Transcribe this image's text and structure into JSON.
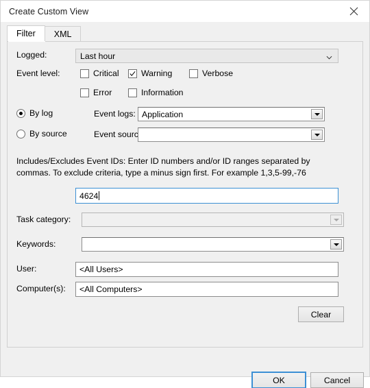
{
  "window": {
    "title": "Create Custom View",
    "close_icon": "close-icon"
  },
  "tabs": [
    {
      "label": "Filter",
      "active": true
    },
    {
      "label": "XML",
      "active": false
    }
  ],
  "filter": {
    "logged": {
      "label": "Logged:",
      "value": "Last hour",
      "chevron_icon": "chevron-down-icon"
    },
    "event_level": {
      "label": "Event level:",
      "options": [
        {
          "label": "Critical",
          "checked": false
        },
        {
          "label": "Warning",
          "checked": true
        },
        {
          "label": "Verbose",
          "checked": false
        },
        {
          "label": "Error",
          "checked": false
        },
        {
          "label": "Information",
          "checked": false
        }
      ]
    },
    "source_mode": {
      "by_log_label": "By log",
      "by_log_selected": true,
      "by_source_label": "By source",
      "by_source_selected": false
    },
    "event_logs": {
      "label": "Event logs:",
      "value": "Application",
      "dropdown_icon": "dropdown-arrow-icon"
    },
    "event_sources": {
      "label": "Event sources:",
      "value": "",
      "dropdown_icon": "dropdown-arrow-icon"
    },
    "event_ids": {
      "help_text": "Includes/Excludes Event IDs: Enter ID numbers and/or ID ranges separated by commas. To exclude criteria, type a minus sign first. For example 1,3,5-99,-76",
      "value": "4624",
      "focused": true
    },
    "task_category": {
      "label": "Task category:",
      "value": "",
      "disabled": true,
      "dropdown_icon": "dropdown-arrow-icon"
    },
    "keywords": {
      "label": "Keywords:",
      "value": "",
      "dropdown_icon": "dropdown-arrow-icon"
    },
    "user": {
      "label": "User:",
      "value": "<All Users>"
    },
    "computers": {
      "label": "Computer(s):",
      "value": "<All Computers>"
    },
    "clear_button": "Clear"
  },
  "footer": {
    "ok_label": "OK",
    "cancel_label": "Cancel"
  },
  "colors": {
    "accent": "#3b8fd4",
    "dialog_bg": "#f0f0f0",
    "panel_bg": "#f0f0f0",
    "title_bg": "#ffffff"
  }
}
